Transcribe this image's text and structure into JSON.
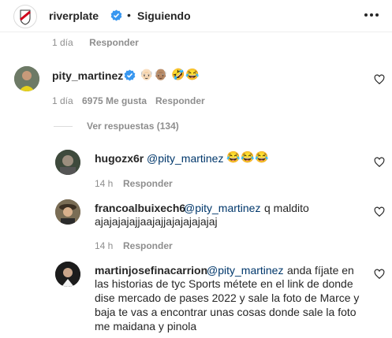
{
  "header": {
    "username": "riverplate",
    "separator": "•",
    "follow_status": "Siguiendo",
    "more_icon": "more-horizontal-icon"
  },
  "prev_comment": {
    "time": "1 día",
    "reply": "Responder"
  },
  "main_comment": {
    "username": "pity_martinez",
    "emojis": [
      "👴🏻",
      "👴🏽",
      "🤣",
      "😂"
    ],
    "time": "1 día",
    "likes": "6975 Me gusta",
    "reply": "Responder",
    "view_replies": "Ver respuestas (134)"
  },
  "replies": [
    {
      "username": "hugozx6r",
      "mention": "@pity_martinez",
      "text": "",
      "emojis": [
        "😂",
        "😂",
        "😂"
      ],
      "time": "14 h",
      "reply": "Responder"
    },
    {
      "username": "francoalbuixech6",
      "mention": "@pity_martinez",
      "text_line1": "q maldito",
      "text_line2": "ajajajajajjaajajjajajajajajaj",
      "time": "14 h",
      "reply": "Responder"
    },
    {
      "username": "martinjosefinacarrion",
      "mention": "@pity_martinez",
      "text_line1": "anda fíjate en",
      "text_line2": "las historias de tyc Sports métete en el link de donde",
      "text_line3": "dise mercado de pases 2022 y sale la foto de Marce y",
      "text_line4": "baja te vas a encontrar unas cosas donde sale la foto",
      "text_line5": "me maidana y pinola"
    }
  ],
  "colors": {
    "verified": "#3897f0",
    "river_red": "#d0021b",
    "mention": "#00376b",
    "meta": "#8e8e8e"
  }
}
